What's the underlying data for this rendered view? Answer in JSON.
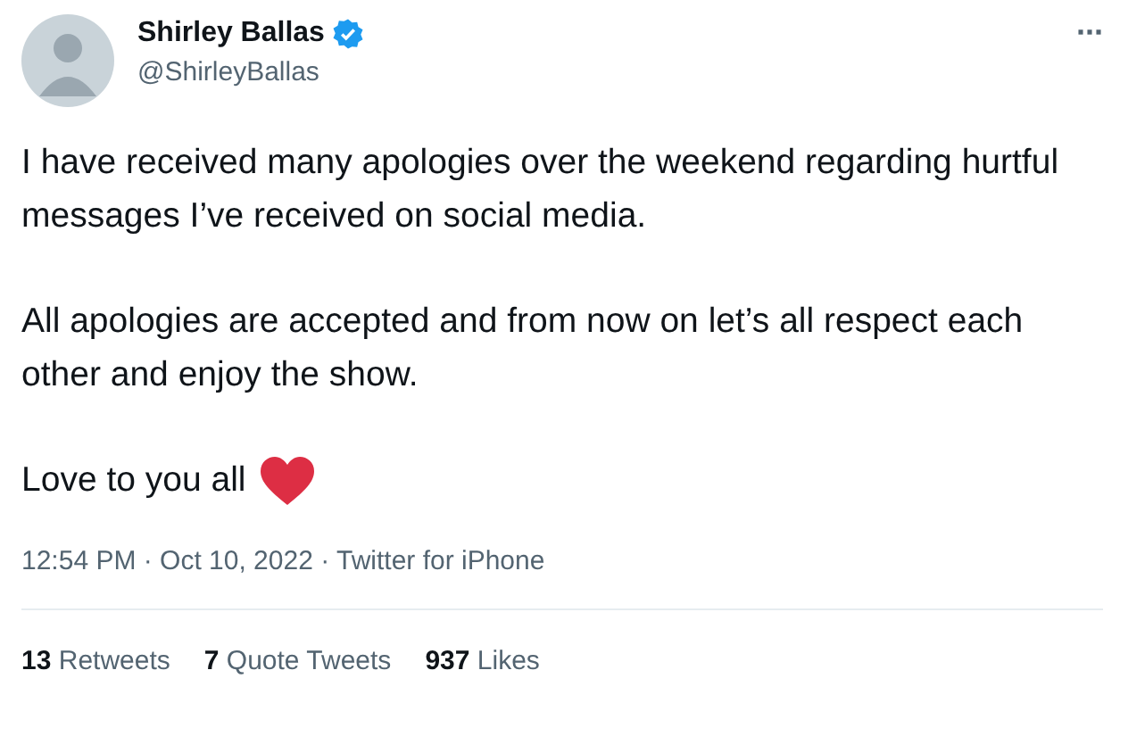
{
  "tweet": {
    "author": {
      "name": "Shirley Ballas",
      "verified": true,
      "handle": "@ShirleyBallas"
    },
    "more": "···",
    "paragraphs": [
      {
        "text": "I have received many apologies over the weekend regarding hurtful messages I’ve received on social media.",
        "heart": false
      },
      {
        "text": "All apologies are accepted and from now on let’s all respect each other and enjoy the show.",
        "heart": false
      },
      {
        "text": "Love to you all",
        "heart": true
      }
    ],
    "timestamp": "12:54 PM · Oct 10, 2022 · Twitter for iPhone",
    "stats": [
      {
        "count": "13",
        "label": "Retweets"
      },
      {
        "count": "7",
        "label": "Quote Tweets"
      },
      {
        "count": "937",
        "label": "Likes"
      }
    ]
  }
}
